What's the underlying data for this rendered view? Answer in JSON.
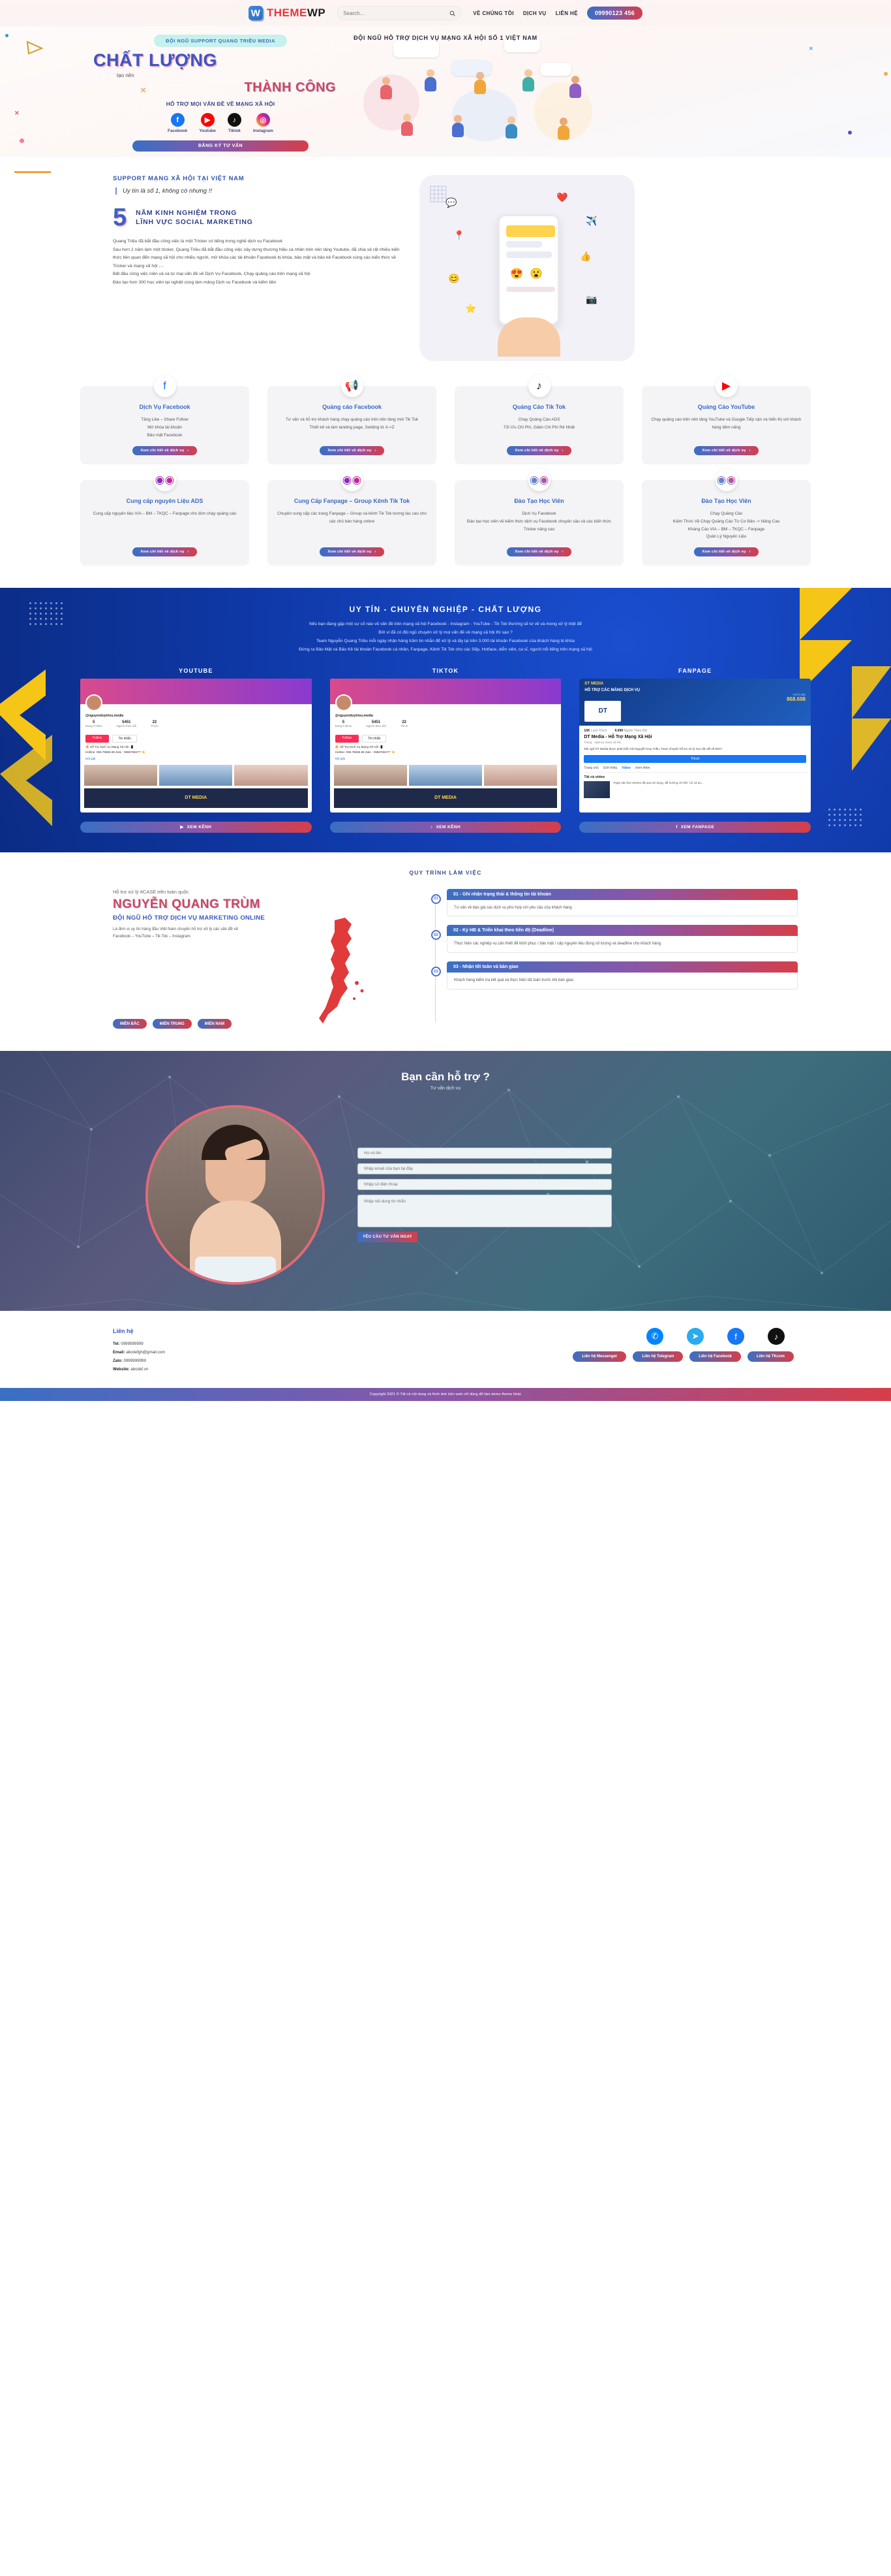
{
  "header": {
    "brand_theme": "THEME",
    "brand_wp": "WP",
    "search_placeholder": "Search...",
    "nav": [
      {
        "label": "VỀ CHÚNG TÔI"
      },
      {
        "label": "DỊCH VỤ"
      },
      {
        "label": "LIÊN HỆ"
      }
    ],
    "phone": "09990123 456"
  },
  "hero": {
    "top_banner": "ĐỘI NGŨ HỖ TRỢ DỊCH VỤ MẠNG XÃ HỘI SỐ 1 VIỆT NAM",
    "pill": "ĐỘI NGŨ SUPPORT QUANG TRIỀU MEDIA",
    "h1": "CHẤT LƯỢNG",
    "sub": "tạo nên",
    "h2": "THÀNH CÔNG",
    "tagline": "HỖ TRỢ MỌI VẤN ĐỀ VỀ MẠNG XÃ HỘI",
    "socials": [
      {
        "name": "Facebook",
        "icon": "facebook-icon"
      },
      {
        "name": "Youtube",
        "icon": "youtube-icon"
      },
      {
        "name": "Tiktok",
        "icon": "tiktok-icon"
      },
      {
        "name": "Instagram",
        "icon": "instagram-icon"
      }
    ],
    "cta": "ĐĂNG KÝ TƯ VẤN"
  },
  "about": {
    "kicker": "SUPPORT MẠNG XÃ HỘI TẠI VIỆT NAM",
    "quote": "Uy tín là số 1, không có nhưng !!",
    "number": "5",
    "number_text": "NĂM KINH NGHIỆM TRONG\nLĨNH VỰC SOCIAL MARKETING",
    "paragraphs": [
      "Quang Triều đã bắt đầu công việc là một Tricker có tiếng trong nghề dịch vụ Facebook",
      "Sau hơn 2 năm làm một tricker, Quang Triều đã bắt đầu công việc xây dựng thương hiệu cá nhân trên nền tảng Youtube, đã chia sẻ rất nhiều kiến thức liên quan đến mạng xã hội cho nhiều người, mở khóa các tài khoản Facebook bị khóa, bảo mật và bảo kê Facebook cùng các kiến thức về Tricker và mạng xã hội ,...",
      "Bất đầu công việc niên và và tư mại vấn đề về Dịch Vụ Facebook, Chạy quảng cáo trên mạng xã hội",
      "Đào tạo hơn 300 học viên tại nghiệt cùng làm mảng Dịch vụ Facebook và kiếm tiền"
    ]
  },
  "services": [
    {
      "icon": "facebook-icon",
      "title": "Dịch Vụ Facebook",
      "desc": "Tăng Like – Share Follow\nMở khóa tài khoản\nBảo mật Facebook",
      "button": "Xem chi tiết về dịch vụ"
    },
    {
      "icon": "facebook-ads-icon",
      "title": "Quảng cáo Facebook",
      "desc": "Tư vấn và hỗ trợ khách hàng chạy quảng cáo trên nền tảng mới Tik Tok\nThiết kế và làm landing page, Setding từ A->Z",
      "button": "Xem chi tiết về dịch vụ"
    },
    {
      "icon": "tiktok-icon",
      "title": "Quảng Cáo Tik Tok",
      "desc": "Chạy Quảng Cáo ADS\nTối Ưu Chi Phí, Giảm Chi Phí Rẻ Nhất",
      "button": "Xem chi tiết về dịch vụ"
    },
    {
      "icon": "youtube-icon",
      "title": "Quảng Cáo YouTube",
      "desc": "Chạy quảng cáo trên nền tảng YouTube và Google Tiếp cận và hiển thị với khách hàng tiềm năng",
      "button": "Xem chi tiết về dịch vụ"
    },
    {
      "icon": "ads-icon",
      "title": "Cung cấp nguyên Liệu ADS",
      "desc": "Cung cấp nguyên liệu VIA – BM – TKQC – Fanpage cho đơn chạy quảng cáo",
      "button": "Xem chi tiết về dịch vụ"
    },
    {
      "icon": "fanpage-icon",
      "title": "Cung Cấp Fanpage – Group Kênh Tik Tok",
      "desc": "Chuyên cung cấp các trang Fanpage – Group và kênh Tik Tok tương tác cao cho các chủ bán hàng online",
      "button": "Xem chi tiết về dịch vụ"
    },
    {
      "icon": "training-icon",
      "title": "Đào Tạo Học Viên",
      "desc": "Dịch Vụ Facebook\nĐào tạo học viên về kiếm thức dịch vụ Facebook chuyên sâu và các kiến thức Tricker nâng cao",
      "button": "Xem chi tiết về dịch vụ"
    },
    {
      "icon": "training2-icon",
      "title": "Đào Tạo Học Viên",
      "desc": "Chạy Quảng Cáo\nKiếm Thức Về Chạy Quảng Cáo Từ Cơ Bản -> Nâng Cao\nKháng Cáo VIA – BM – TKQC – Fanpage\nQuản Lý Nguyên Liệu",
      "button": "Xem chi tiết về dịch vụ"
    }
  ],
  "band": {
    "title": "UY TÍN - CHUYÊN NGHIỆP - CHẤT LƯỢNG",
    "paragraphs": [
      "Nếu bạn đang gặp một sự cố nào về vấn đề trên mạng xã hội Facebook - Instagram - YouTube - Tik Tok thường sẽ tư về và mong xử lý triệt để",
      "Bởi vì đã có đội ngũ chuyên xử lý mọi vấn đề về mạng xã hội thì sao ?",
      "Team Nguyễn Quang Triều mỗi ngày nhận hàng trăm tin nhắn để xử lý và lấy lại trên 3.000 tài khoản Facebook của khách hàng bị khóa",
      "Đứng ra Bảo Mật và Bảo Kê tài khoản Facebook cá nhân, Fanpage, Kênh Tik Tok cho các Sếp, Hotface, diễn viên, ca sĩ, người nổi tiếng trên mạng xã hội"
    ],
    "columns": [
      {
        "label": "YOUTUBE",
        "button": "XEM KÊNH",
        "icon": "youtube-icon"
      },
      {
        "label": "TIKTOK",
        "button": "XEM KÊNH",
        "icon": "tiktok-icon"
      },
      {
        "label": "FANPAGE",
        "button": "XEM FANPAGE",
        "icon": "facebook-icon"
      }
    ],
    "cards": {
      "yt": {
        "handle": "@nguyenduytrieu.media",
        "stats": [
          {
            "value": "5",
            "label": "Đang Follow"
          },
          {
            "value": "5451",
            "label": "Người theo dõi"
          },
          {
            "value": "22",
            "label": "Thích"
          }
        ],
        "btn_follow": "Follow",
        "btn_more": "Tin nhắn",
        "bio1": "🔥 Hỗ Trợ Dịch Vụ Mạng Xã Hội 📲",
        "bio2": "Hotline: 086.78686.98 Zalo : 0986786277 👈",
        "link": "Nổi giải",
        "badge": "DT MEDIA"
      },
      "tt": {
        "handle": "@nguyenduytrieu.media",
        "stats": [
          {
            "value": "5",
            "label": "Đang Follow"
          },
          {
            "value": "5451",
            "label": "Người theo dõi"
          },
          {
            "value": "22",
            "label": "Thích"
          }
        ],
        "btn_follow": "Follow",
        "btn_more": "Tin nhắn",
        "bio1": "🔥 Hỗ Trợ Dịch Vụ Mạng Xã Hội 📲",
        "bio2": "Hotline: 086.78686.98 Zalo : 0986786277 👈",
        "link": "Nổi giải",
        "badge": "DT MEDIA"
      },
      "fp": {
        "brand": "DT MEDIA",
        "headline": "HỖ TRỢ CÁC MẢNG DỊCH VỤ",
        "hotline_label": "HOTLINE",
        "hotline": "868.698",
        "follow_count": "10K",
        "follow_label": "Lượt Thích",
        "likes": "9.999",
        "likes_label": "Người Theo Dõi",
        "name": "DT Media - Hỗ Trợ Mạng Xã Hội",
        "category": "Trang · Agency marạ xã hội",
        "desc": "Đội ngũ DT Media được phát triển bởi Nguyễn Duy Triều, Team chuyên hỗ trợ xử lý mọi vấn đề về MXH",
        "btn_like": "Thích",
        "tabs": [
          "Trang chủ",
          "Giới thiệu",
          "Video",
          "Xem thêm"
        ],
        "video_title": "Tất cả video",
        "video_desc": "Page sản live stream đã qua sử dụng, đã hướng chi tiết. Có cả an..."
      }
    }
  },
  "process": {
    "title": "QUY TRÌNH LÀM VIỆC",
    "kicker": "Hỗ trợ xử lý #CASE trên toàn quốc",
    "h1": "NGUYỄN QUANG TRÙM",
    "h2": "ĐỘI NGŨ HỖ TRỢ DỊCH VỤ MARKETING ONLINE",
    "lines": [
      "Là đơn vị uy tín hàng đầu Việt Nam chuyên hỗ trợ xử lý các vấn đề về",
      "Facebook – YouTube – Tik Tok – Instagram."
    ],
    "regions": [
      "MIỀN BẮC",
      "MIỀN TRUNG",
      "MIỀN NAM"
    ],
    "steps": [
      {
        "num": "01",
        "title": "01 - Ghi nhận trạng thái & thông tin tài khoản",
        "body": "Tư vấn về báo giá các dịch vụ phù hợp với yêu cầu của khách hàng"
      },
      {
        "num": "02",
        "title": "02 - Ký HĐ & Triển khai theo tiến độ (Deadline)",
        "body": "Thực hiện các nghiệp vụ cần thiết để khởi phục / bảo mật / cấp nguyên liệu đúng số lượng và deadline cho khách hàng"
      },
      {
        "num": "03",
        "title": "03 - Nhận tốt toàn và bàn giao",
        "body": "Khách hàng kiểm tra kết quả và thực hiện tất toán trước khi bàn giao"
      }
    ]
  },
  "contact": {
    "title": "Bạn cần hỗ trợ ?",
    "subtitle": "Tư vấn dịch vụ",
    "fields": [
      {
        "name": "name-field",
        "placeholder": "Họ và tên"
      },
      {
        "name": "email-field",
        "placeholder": "Nhập email của bạn tại đây"
      },
      {
        "name": "phone-field",
        "placeholder": "Nhập số điện thoại"
      },
      {
        "name": "message-field",
        "placeholder": "Nhập nội dung tin nhắn"
      }
    ],
    "submit": "YÊU CẦU TƯ VẤN NGAY"
  },
  "footer": {
    "title": "Liên hệ",
    "rows": [
      {
        "label": "Tel:",
        "value": "0999999999"
      },
      {
        "label": "Email:",
        "value": "abcdefgh@gmail.com"
      },
      {
        "label": "Zalo:",
        "value": "0999999999"
      },
      {
        "label": "Website:",
        "value": "abcdef.vn"
      }
    ],
    "social_icons": [
      {
        "name": "messenger-icon",
        "glyph": "✆",
        "color": "#0084ff"
      },
      {
        "name": "telegram-icon",
        "glyph": "➤",
        "color": "#2aabee"
      },
      {
        "name": "facebook-icon",
        "glyph": "f",
        "color": "#1877f2"
      },
      {
        "name": "tiktok-icon",
        "glyph": "♪",
        "color": "#111111"
      }
    ],
    "social_buttons": [
      {
        "label": "Liên hệ Messenger"
      },
      {
        "label": "Liên hệ Telegram"
      },
      {
        "label": "Liên hệ Facebook"
      },
      {
        "label": "Liên hệ TKcom"
      }
    ],
    "copyright": "Copyright 2021 © Tất cả nội dung và hình ảnh trên web chỉ dùng để làm demo theme khác"
  },
  "colors": {
    "brand_blue": "#3a56c4",
    "brand_red": "#d0455c",
    "band_blue": "#0f39a8",
    "accent_yellow": "#f5c518",
    "mint": "#c7f1ec"
  }
}
